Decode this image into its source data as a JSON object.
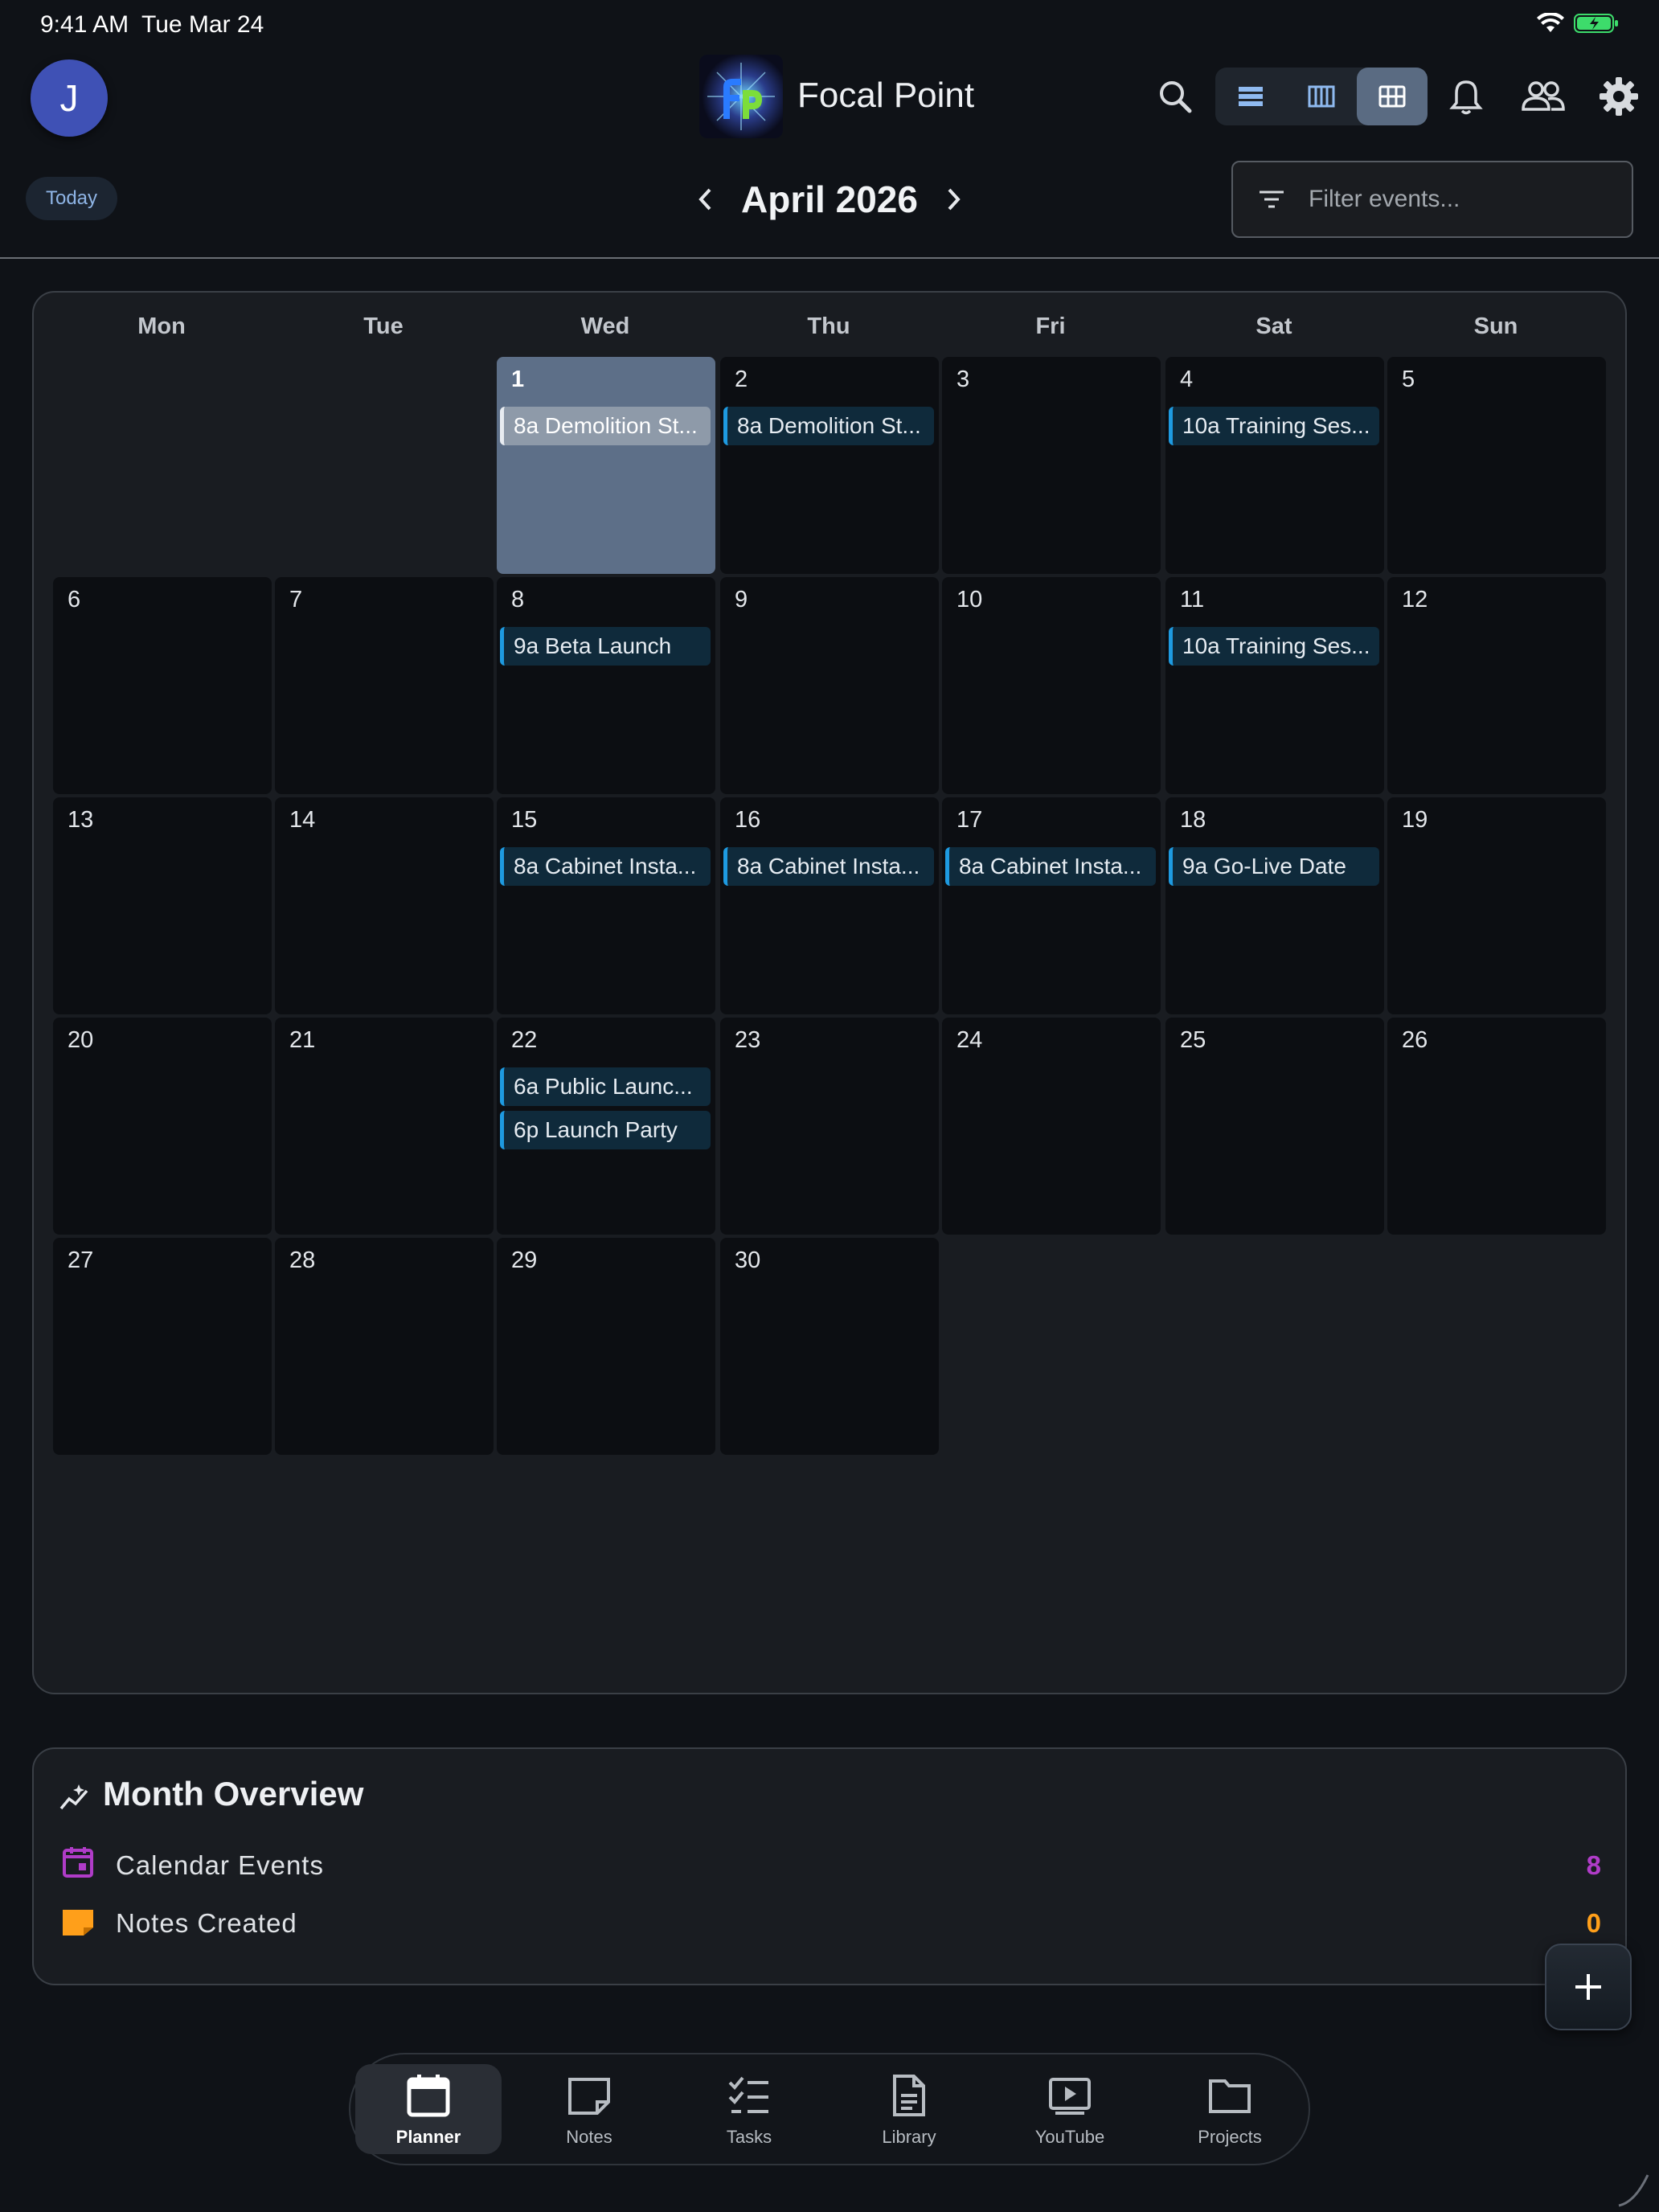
{
  "status_bar": {
    "time": "9:41 AM",
    "date": "Tue Mar 24"
  },
  "header": {
    "avatar_initial": "J",
    "app_title": "Focal Point",
    "icons": [
      "search-icon",
      "list-view-icon",
      "week-view-icon",
      "month-view-icon",
      "bell-icon",
      "people-icon",
      "gear-icon"
    ],
    "active_view": "month"
  },
  "toolbar": {
    "today_label": "Today",
    "month_label": "April 2026",
    "filter_placeholder": "Filter events..."
  },
  "calendar": {
    "weekdays": [
      "Mon",
      "Tue",
      "Wed",
      "Thu",
      "Fri",
      "Sat",
      "Sun"
    ],
    "today": 1,
    "days": [
      {
        "day": "1",
        "events": [
          "8a Demolition St..."
        ]
      },
      {
        "day": "2",
        "events": [
          "8a Demolition St..."
        ]
      },
      {
        "day": "3",
        "events": []
      },
      {
        "day": "4",
        "events": [
          "10a Training Ses..."
        ]
      },
      {
        "day": "5",
        "events": []
      },
      {
        "day": "6",
        "events": []
      },
      {
        "day": "7",
        "events": []
      },
      {
        "day": "8",
        "events": [
          "9a Beta Launch"
        ]
      },
      {
        "day": "9",
        "events": []
      },
      {
        "day": "10",
        "events": []
      },
      {
        "day": "11",
        "events": [
          "10a Training Ses..."
        ]
      },
      {
        "day": "12",
        "events": []
      },
      {
        "day": "13",
        "events": []
      },
      {
        "day": "14",
        "events": []
      },
      {
        "day": "15",
        "events": [
          "8a Cabinet Insta..."
        ]
      },
      {
        "day": "16",
        "events": [
          "8a Cabinet Insta..."
        ]
      },
      {
        "day": "17",
        "events": [
          "8a Cabinet Insta..."
        ]
      },
      {
        "day": "18",
        "events": [
          "9a Go-Live Date"
        ]
      },
      {
        "day": "19",
        "events": []
      },
      {
        "day": "20",
        "events": []
      },
      {
        "day": "21",
        "events": []
      },
      {
        "day": "22",
        "events": [
          "6a Public Launc...",
          "6p Launch Party"
        ]
      },
      {
        "day": "23",
        "events": []
      },
      {
        "day": "24",
        "events": []
      },
      {
        "day": "25",
        "events": []
      },
      {
        "day": "26",
        "events": []
      },
      {
        "day": "27",
        "events": []
      },
      {
        "day": "28",
        "events": []
      },
      {
        "day": "29",
        "events": []
      },
      {
        "day": "30",
        "events": []
      }
    ]
  },
  "overview": {
    "title": "Month Overview",
    "rows": [
      {
        "label": "Calendar Events",
        "count": "8",
        "color": "#b03cc8",
        "icon": "calendar-icon"
      },
      {
        "label": "Notes Created",
        "count": "0",
        "color": "#ff9f1a",
        "icon": "note-icon"
      }
    ]
  },
  "bottom_nav": {
    "items": [
      {
        "label": "Planner",
        "icon": "calendar-icon",
        "active": true
      },
      {
        "label": "Notes",
        "icon": "note-icon",
        "active": false
      },
      {
        "label": "Tasks",
        "icon": "checklist-icon",
        "active": false
      },
      {
        "label": "Library",
        "icon": "document-icon",
        "active": false
      },
      {
        "label": "YouTube",
        "icon": "play-icon",
        "active": false
      },
      {
        "label": "Projects",
        "icon": "folder-icon",
        "active": false
      }
    ]
  },
  "colors": {
    "accent_event": "#1e9ae0",
    "today_cell": "#5d6f88"
  }
}
